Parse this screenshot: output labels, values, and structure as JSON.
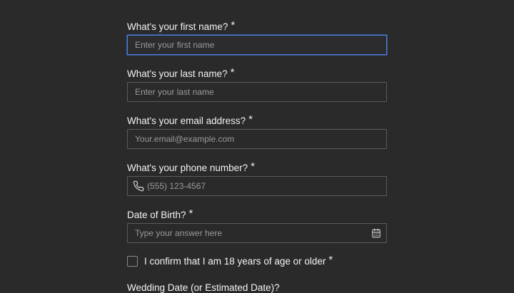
{
  "required_mark": "*",
  "fields": {
    "first_name": {
      "label": "What's your first name?",
      "placeholder": "Enter your first name"
    },
    "last_name": {
      "label": "What's your last name?",
      "placeholder": "Enter your last name"
    },
    "email": {
      "label": "What's your email address?",
      "placeholder": "Your.email@example.com"
    },
    "phone": {
      "label": "What's your phone number?",
      "placeholder": "(555) 123-4567",
      "icon": "phone-icon"
    },
    "dob": {
      "label": "Date of Birth?",
      "placeholder": "Type your answer here",
      "icon": "calendar-icon"
    },
    "age_confirm": {
      "label": "I confirm that I am 18 years of age or older",
      "checked": false
    },
    "wedding_date": {
      "label": "Wedding Date (or Estimated Date)?"
    }
  },
  "colors": {
    "background": "#2a2a2b",
    "border": "#5b5b5e",
    "focus": "#4a7fd6",
    "text": "#f4f4f4",
    "placeholder": "#9a9a9d"
  }
}
